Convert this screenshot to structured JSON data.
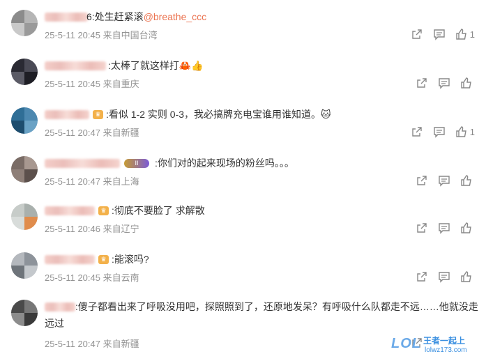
{
  "comments": [
    {
      "text_prefix": "6:处生赶紧滚",
      "mention": "@breathe_ccc",
      "meta": "25-5-11 20:45 来自中国台湾",
      "likes": "1"
    },
    {
      "text": ":太棒了就这样打🦀👍",
      "meta": "25-5-11 20:45 来自重庆",
      "likes": ""
    },
    {
      "badge": "♛",
      "text": ":看似 1-2 实则 0-3，我必搞牌充电宝谁用谁知道。🐱",
      "meta": "25-5-11 20:47 来自新疆",
      "likes": "1"
    },
    {
      "badge_level": "II",
      "text": ":你们对的起来现场的粉丝吗。。。",
      "meta": "25-5-11 20:47 来自上海",
      "likes": ""
    },
    {
      "badge": "♛",
      "text": ":彻底不要脸了 求解散",
      "meta": "25-5-11 20:46 来自辽宁",
      "likes": ""
    },
    {
      "badge": "♛",
      "text": ":能滚吗?",
      "meta": "25-5-11 20:45 来自云南",
      "likes": ""
    },
    {
      "text": ":傻子都看出来了呼吸没用吧，探照照到了，还原地发呆？有呼吸什么队都走不远……他就没走远过",
      "meta": "25-5-11 20:47 来自新疆",
      "likes": ""
    }
  ],
  "icons": {
    "share": "share-icon",
    "comment": "comment-icon",
    "like": "thumb-up-icon"
  },
  "watermark": {
    "logo": "LOL",
    "title": "王者一起上",
    "url": "lolwz173.com"
  }
}
